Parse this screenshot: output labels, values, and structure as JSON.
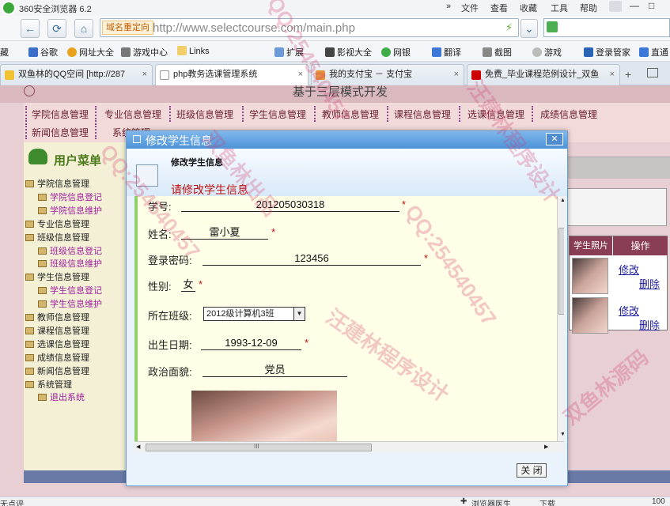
{
  "browser": {
    "title": "360安全浏览器 6.2",
    "menu": [
      "文件",
      "查看",
      "收藏",
      "工具",
      "帮助"
    ],
    "redirect_tag": "域名重定向",
    "url": "http://www.selectcourse.com/main.php",
    "favorites": [
      "藏",
      "谷歌",
      "网址大全",
      "游戏中心",
      "Links",
      "扩展",
      "影视大全",
      "网银",
      "翻译",
      "截图",
      "游戏",
      "登录管家",
      "直通"
    ],
    "tabs": [
      {
        "label": "双鱼林的QQ空间 [http://287",
        "icon_color": "#f1c232"
      },
      {
        "label": "php教务选课管理系统",
        "icon_color": "#ffffff"
      },
      {
        "label": "我的支付宝 － 支付宝",
        "icon_color": "#e69138"
      },
      {
        "label": "免费_毕业课程范例设计_双鱼",
        "icon_color": "#cc0000"
      }
    ],
    "status": {
      "left": "无点评",
      "security": "浏览器医生",
      "download": "下载",
      "zoom": "100"
    }
  },
  "page": {
    "heading": "基于三层模式开发",
    "topnav": [
      "学院信息管理",
      "专业信息管理",
      "班级信息管理",
      "学生信息管理",
      "教师信息管理",
      "课程信息管理",
      "选课信息管理",
      "成绩信息管理",
      "新闻信息管理",
      "系统管理"
    ],
    "side_title": "用户菜单",
    "side_menu": [
      {
        "label": "学院信息管理",
        "sub": false
      },
      {
        "label": "学院信息登记",
        "sub": true
      },
      {
        "label": "学院信息维护",
        "sub": true
      },
      {
        "label": "专业信息管理",
        "sub": false
      },
      {
        "label": "班级信息管理",
        "sub": false
      },
      {
        "label": "班级信息登记",
        "sub": true
      },
      {
        "label": "班级信息维护",
        "sub": true
      },
      {
        "label": "学生信息管理",
        "sub": false
      },
      {
        "label": "学生信息登记",
        "sub": true
      },
      {
        "label": "学生信息维护",
        "sub": true
      },
      {
        "label": "教师信息管理",
        "sub": false
      },
      {
        "label": "课程信息管理",
        "sub": false
      },
      {
        "label": "选课信息管理",
        "sub": false
      },
      {
        "label": "成绩信息管理",
        "sub": false
      },
      {
        "label": "新闻信息管理",
        "sub": false
      },
      {
        "label": "系统管理",
        "sub": false
      },
      {
        "label": "退出系统",
        "sub": true
      }
    ],
    "grid": {
      "col_photo": "学生照片",
      "col_action": "操作",
      "edit": "修改",
      "delete": "删除"
    }
  },
  "dialog": {
    "title": "修改学生信息",
    "header_title": "修改学生信息",
    "form_heading": "请修改学生信息",
    "fields": {
      "student_no": {
        "label": "学号:",
        "value": "201205030318"
      },
      "name": {
        "label": "姓名:",
        "value": "雷小夏"
      },
      "password": {
        "label": "登录密码:",
        "value": "123456"
      },
      "gender": {
        "label": "性别:",
        "value": "女"
      },
      "class": {
        "label": "所在班级:",
        "value": "2012级计算机3班"
      },
      "birthday": {
        "label": "出生日期:",
        "value": "1993-12-09"
      },
      "politics": {
        "label": "政治面貌:",
        "value": "党员"
      }
    },
    "required_mark": "*",
    "close_button": "关 闭",
    "scroll_mid": "III"
  },
  "watermarks": [
    "QQ:254540457",
    "汪建林程序设计",
    "双鱼林出品",
    "双鱼林源码"
  ]
}
